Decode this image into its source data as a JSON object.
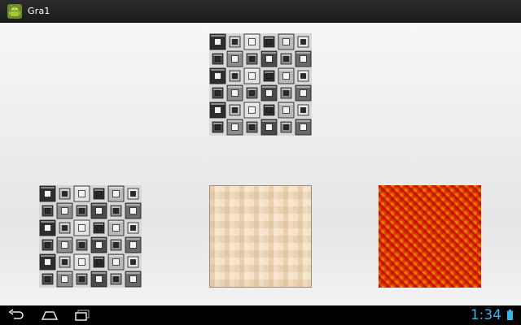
{
  "app": {
    "title": "Gra1",
    "icon": "android-robot-icon",
    "accent_color": "#33b5e5"
  },
  "content": {
    "tiles": [
      {
        "pattern": "gray-bevel-squares"
      },
      {
        "pattern": "gray-bevel-squares"
      },
      {
        "pattern": "beige-woven-texture"
      },
      {
        "pattern": "red-yellow-herringbone"
      }
    ]
  },
  "navigation": {
    "buttons": [
      "back-icon",
      "home-icon",
      "recents-icon"
    ]
  },
  "status": {
    "time": "1:34",
    "battery_icon": "battery-icon"
  }
}
